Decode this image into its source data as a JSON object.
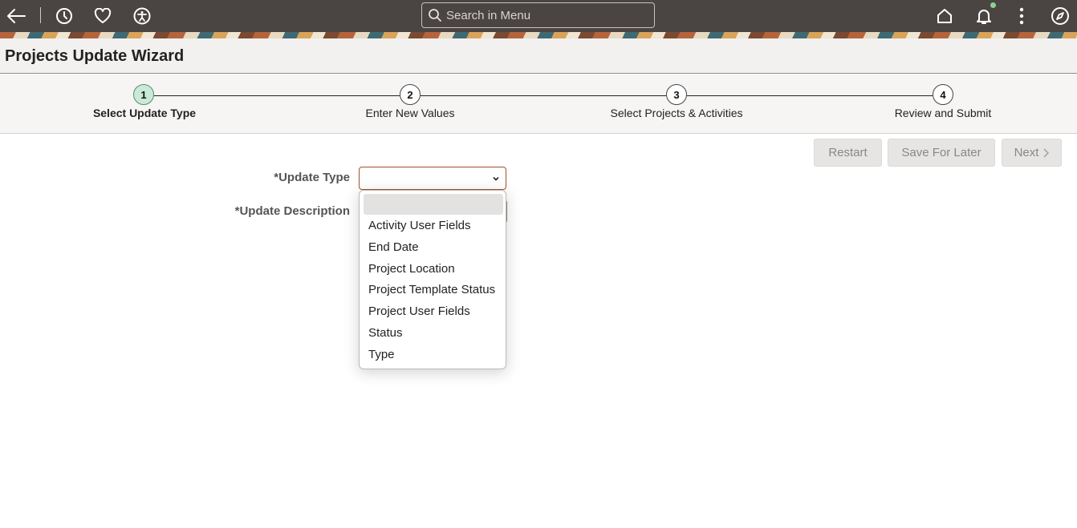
{
  "topbar": {
    "search_placeholder": "Search in Menu",
    "icons": [
      "back-arrow-icon",
      "history-icon",
      "favorites-heart-icon",
      "accessibility-icon",
      "home-icon",
      "bell-icon",
      "more-vertical-icon",
      "compass-icon"
    ]
  },
  "page": {
    "title": "Projects Update Wizard"
  },
  "steps": [
    {
      "number": "1",
      "label": "Select Update Type",
      "active": true
    },
    {
      "number": "2",
      "label": "Enter New Values",
      "active": false
    },
    {
      "number": "3",
      "label": "Select Projects & Activities",
      "active": false
    },
    {
      "number": "4",
      "label": "Review and Submit",
      "active": false
    }
  ],
  "toolbar": {
    "restart": "Restart",
    "save_for_later": "Save For Later",
    "next": "Next"
  },
  "form": {
    "update_type_label": "*Update Type",
    "update_type_value": "",
    "update_description_label": "*Update Description"
  },
  "dropdown": {
    "options": [
      "",
      "Activity User Fields",
      "End Date",
      "Project Location",
      "Project Template Status",
      "Project User Fields",
      "Status",
      "Type"
    ]
  },
  "colors": {
    "topbar": "#4a4543",
    "accent_step": "#c9ead7",
    "select_border": "#a0522d"
  }
}
